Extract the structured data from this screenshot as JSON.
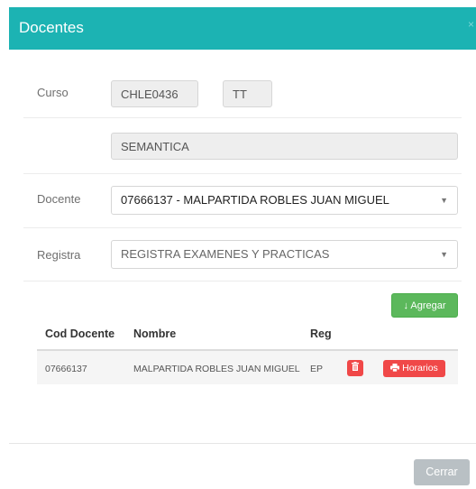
{
  "header": {
    "title": "Docentes",
    "close_label": "×"
  },
  "form": {
    "curso_label": "Curso",
    "curso_code": "CHLE0436",
    "curso_section": "TT",
    "curso_name": "SEMANTICA",
    "docente_label": "Docente",
    "docente_value": "07666137 - MALPARTIDA ROBLES JUAN MIGUEL",
    "registra_label": "Registra",
    "registra_value": "REGISTRA EXAMENES Y PRACTICAS"
  },
  "actions": {
    "agregar_label": "Agregar",
    "agregar_icon": "↓"
  },
  "table": {
    "headers": [
      "Cod Docente",
      "Nombre",
      "Reg"
    ],
    "rows": [
      {
        "cod": "07666137",
        "nombre": "MALPARTIDA ROBLES JUAN MIGUEL",
        "reg": "EP",
        "horarios_label": "Horarios"
      }
    ]
  },
  "footer": {
    "cerrar_label": "Cerrar"
  },
  "colors": {
    "header": "#1cb3b3",
    "success": "#5cb85c",
    "danger": "#f04848",
    "muted_button": "#b9c0c4"
  }
}
